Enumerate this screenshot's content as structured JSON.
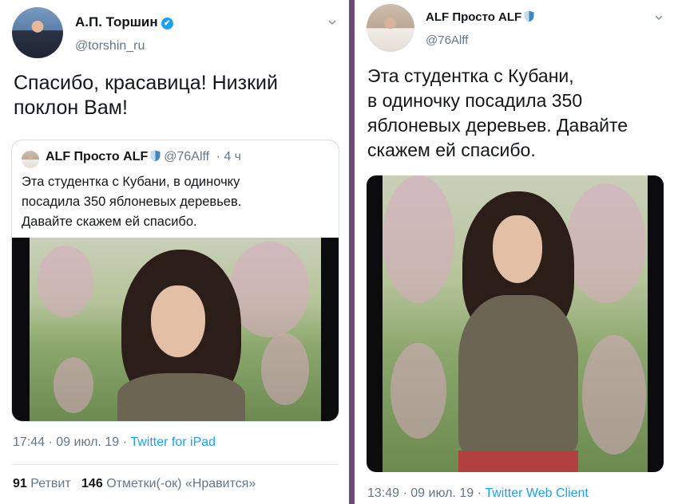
{
  "left_tweet": {
    "author_name": "А.П. Торшин",
    "author_handle": "@torshin_ru",
    "avatar_icon": "avatar-torshin",
    "text": "Спасибо, красавица! Низкий\nпоклон Вам!",
    "quoted": {
      "author_name": "ALF Просто ALF",
      "author_handle": "@76Alff",
      "time_ago": "4 ч",
      "text": "Эта студентка с Кубани, в одиночку\nпосадила 350 яблоневых деревьев.\nДавайте скажем ей спасибо."
    },
    "time": "17:44",
    "date": "09 июл. 19",
    "source": "Twitter for iPad",
    "retweets_count": "91",
    "retweets_label": "Ретвит",
    "likes_count": "146",
    "likes_label": "Отметки(-ок) «Нравится»"
  },
  "right_tweet": {
    "author_name": "ALF Просто ALF",
    "author_handle": "@76Alff",
    "avatar_icon": "avatar-alf",
    "text": "Эта студентка с Кубани,\nв одиночку посадила 350\nяблоневых деревьев. Давайте\nскажем ей спасибо.",
    "time": "13:49",
    "date": "09 июл. 19",
    "source": "Twitter Web Client"
  },
  "colors": {
    "accent": "#1da1f2",
    "secondary_text": "#657786",
    "divider": "#6e4a78"
  }
}
